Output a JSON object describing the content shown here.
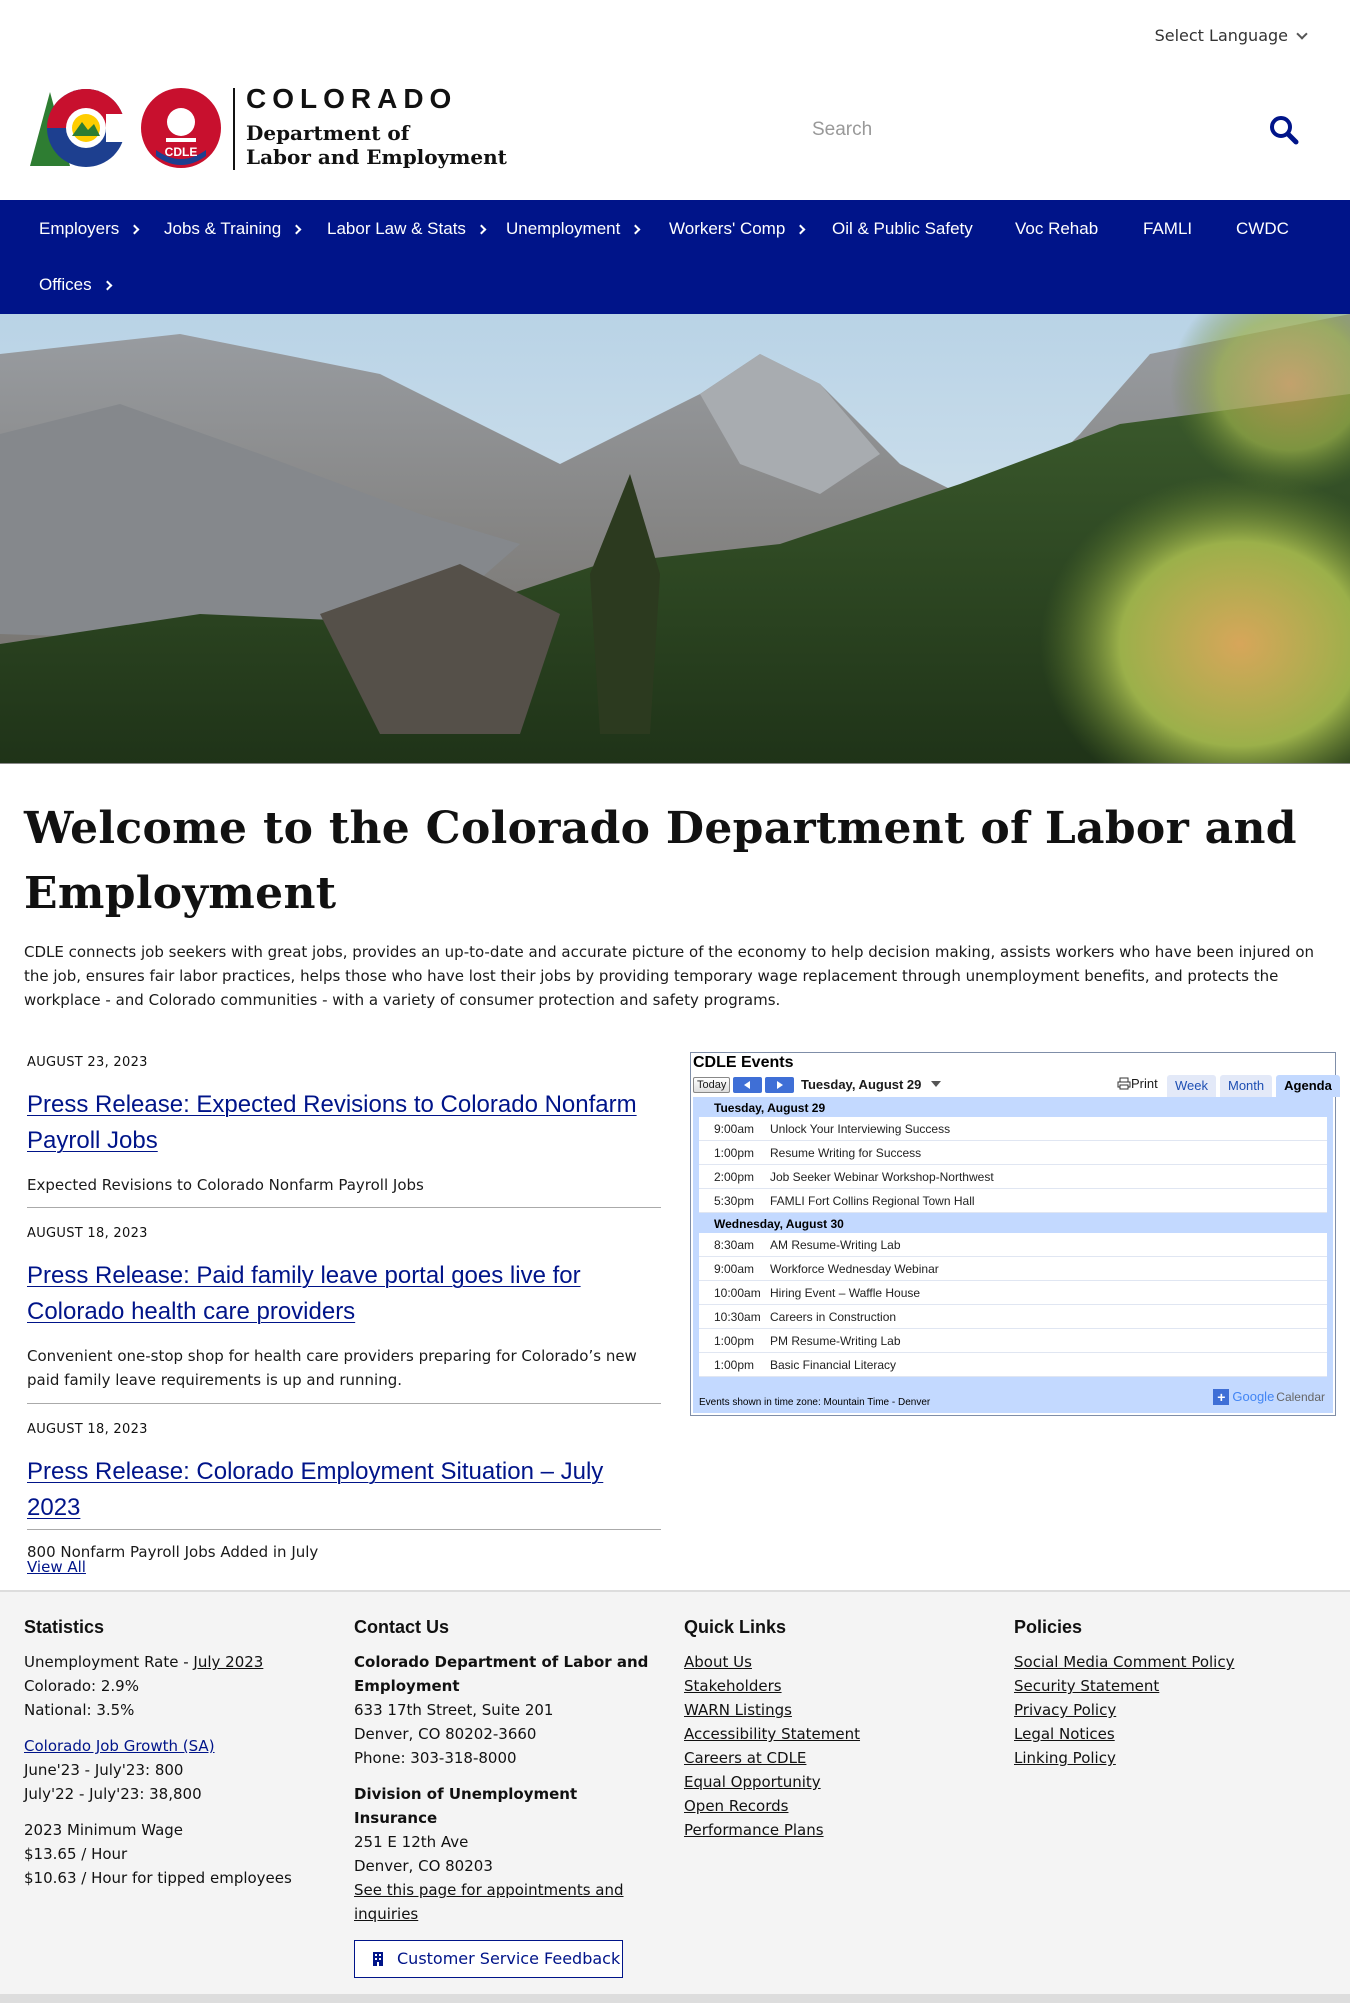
{
  "header": {
    "language_label": "Select Language",
    "logo": {
      "wordmark": "COLORADO",
      "badge": "CDLE",
      "dept_line1": "Department of",
      "dept_line2": "Labor and Employment"
    },
    "search_placeholder": "Search"
  },
  "nav": {
    "items": [
      {
        "label": "Employers",
        "has_sub": true
      },
      {
        "label": "Jobs & Training",
        "has_sub": true
      },
      {
        "label": "Labor Law & Stats",
        "has_sub": true
      },
      {
        "label": "Unemployment",
        "has_sub": true
      },
      {
        "label": "Workers' Comp",
        "has_sub": true
      },
      {
        "label": "Oil & Public Safety",
        "has_sub": false
      },
      {
        "label": "Voc Rehab",
        "has_sub": false
      },
      {
        "label": "FAMLI",
        "has_sub": false
      },
      {
        "label": "CWDC",
        "has_sub": false
      },
      {
        "label": "Offices",
        "has_sub": true
      }
    ]
  },
  "main": {
    "title": "Welcome to the Colorado Department of Labor and Employment",
    "intro": "CDLE connects job seekers with great jobs, provides an up-to-date and accurate picture of the economy to help decision making, assists workers who have been injured on the job, ensures fair labor practices, helps those who have lost their jobs by providing temporary wage replacement through unemployment benefits, and protects the workplace - and Colorado communities - with a variety of consumer protection and safety programs.",
    "news": [
      {
        "date": "AUGUST 23, 2023",
        "title": "Press Release: Expected Revisions to Colorado Nonfarm Payroll Jobs",
        "desc": "Expected Revisions to Colorado Nonfarm Payroll Jobs"
      },
      {
        "date": "AUGUST 18, 2023",
        "title": "Press Release: Paid family leave portal goes live for Colorado health care providers",
        "desc": "Convenient one-stop shop for health care providers preparing for Colorado’s new paid family leave requirements is up and running."
      },
      {
        "date": "AUGUST 18, 2023",
        "title": "Press Release: Colorado Employment Situation – July 2023",
        "desc": "800 Nonfarm Payroll Jobs Added in July"
      }
    ],
    "view_all": "View All"
  },
  "calendar": {
    "title": "CDLE Events",
    "today": "Today",
    "current_date": "Tuesday, August 29",
    "print": "Print",
    "tabs": [
      "Week",
      "Month",
      "Agenda"
    ],
    "active_tab": "Agenda",
    "days": [
      {
        "label": "Tuesday, August 29",
        "events": [
          {
            "time": "9:00am",
            "title": "Unlock Your Interviewing Success"
          },
          {
            "time": "1:00pm",
            "title": "Resume Writing for Success"
          },
          {
            "time": "2:00pm",
            "title": "Job Seeker Webinar Workshop-Northwest"
          },
          {
            "time": "5:30pm",
            "title": "FAMLI Fort Collins Regional Town Hall"
          }
        ]
      },
      {
        "label": "Wednesday, August 30",
        "events": [
          {
            "time": "8:30am",
            "title": "AM Resume-Writing Lab"
          },
          {
            "time": "9:00am",
            "title": "Workforce Wednesday Webinar"
          },
          {
            "time": "10:00am",
            "title": "Hiring Event – Waffle House"
          },
          {
            "time": "10:30am",
            "title": "Careers in Construction"
          },
          {
            "time": "1:00pm",
            "title": "PM Resume-Writing Lab"
          },
          {
            "time": "1:00pm",
            "title": "Basic Financial Literacy"
          }
        ]
      }
    ],
    "timezone_note": "Events shown in time zone: Mountain Time - Denver",
    "google_calendar": {
      "google": "Google",
      "calendar": "Calendar"
    }
  },
  "footer": {
    "statistics": {
      "heading": "Statistics",
      "unemp_label": "Unemployment Rate - ",
      "unemp_link": "July 2023",
      "colorado": "Colorado: 2.9%",
      "national": "National: 3.5%",
      "growth_link": "Colorado Job Growth (SA)",
      "growth_1": "June'23 - July'23: 800",
      "growth_2": "July'22 - July'23: 38,800",
      "min_wage_label": "2023 Minimum Wage",
      "min_wage_1": "$13.65 / Hour",
      "min_wage_2": "$10.63 / Hour for tipped employees"
    },
    "contact": {
      "heading": "Contact Us",
      "org": "Colorado Department of Labor and Employment",
      "addr1": "633 17th Street, Suite 201",
      "addr2": "Denver, CO  80202-3660",
      "phone": "Phone: 303-318-8000",
      "div": "Division of Unemployment Insurance",
      "div_addr1": "251 E 12th Ave",
      "div_addr2": "Denver, CO  80203",
      "appt_link": "See this page for appointments and inquiries",
      "feedback_button": "Customer Service Feedback"
    },
    "quick_links": {
      "heading": "Quick Links",
      "items": [
        "About Us",
        "Stakeholders",
        "WARN Listings",
        "Accessibility Statement",
        "Careers at CDLE",
        "Equal Opportunity",
        "Open Records",
        "Performance Plans"
      ]
    },
    "policies": {
      "heading": "Policies",
      "items": [
        "Social Media Comment Policy",
        "Security Statement",
        "Privacy Policy",
        "Legal Notices",
        "Linking Policy"
      ]
    }
  },
  "colors": {
    "nav_bg": "#001489",
    "link": "#001489",
    "brand_red": "#c8102e",
    "brand_yellow": "#ffcd00",
    "brand_green": "#2e7d32"
  }
}
